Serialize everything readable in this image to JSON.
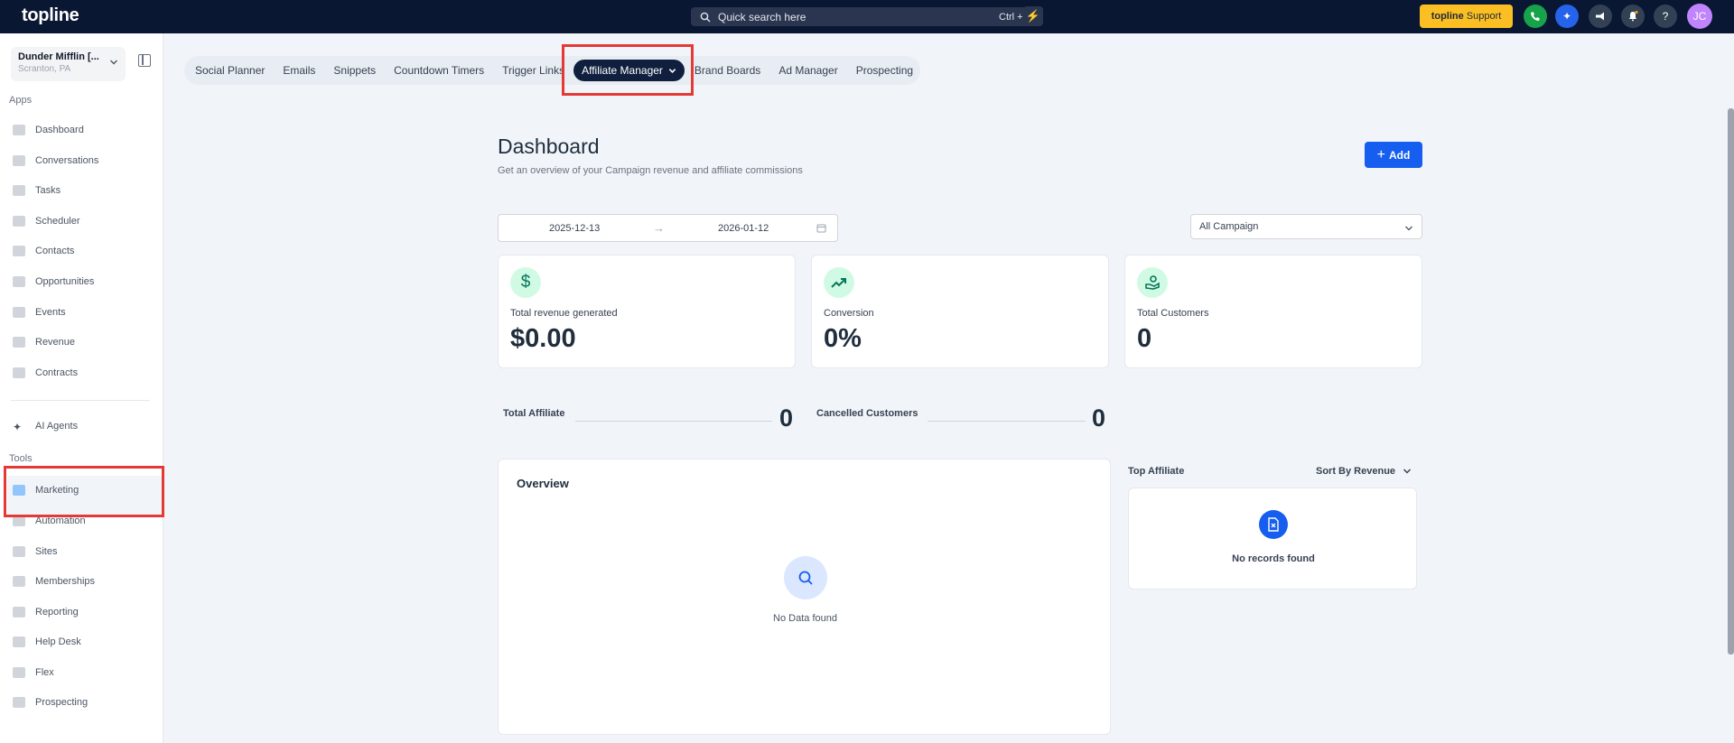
{
  "brand": {
    "logo": "topline"
  },
  "search": {
    "placeholder": "Quick search here",
    "shortcut": "Ctrl + K"
  },
  "header": {
    "support_brand": "topline",
    "support_label": "Support",
    "avatar_initials": "JC",
    "colors": {
      "support_bg": "#fbbf24",
      "phone": "#16a34a",
      "ai": "#2563eb",
      "avatar": "#c084fc"
    }
  },
  "account": {
    "name": "Dunder Mifflin [...",
    "location": "Scranton, PA"
  },
  "sidebar": {
    "apps_heading": "Apps",
    "apps": [
      {
        "label": "Dashboard",
        "icon": "dashboard-icon"
      },
      {
        "label": "Conversations",
        "icon": "chat-icon"
      },
      {
        "label": "Tasks",
        "icon": "tasks-icon"
      },
      {
        "label": "Scheduler",
        "icon": "calendar-icon"
      },
      {
        "label": "Contacts",
        "icon": "contact-icon"
      },
      {
        "label": "Opportunities",
        "icon": "opportunities-icon"
      },
      {
        "label": "Events",
        "icon": "events-icon"
      },
      {
        "label": "Revenue",
        "icon": "card-icon"
      },
      {
        "label": "Contracts",
        "icon": "contract-icon"
      }
    ],
    "ai_agents": "AI Agents",
    "tools_heading": "Tools",
    "tools": [
      {
        "label": "Marketing",
        "icon": "megaphone-icon",
        "active": true
      },
      {
        "label": "Automation",
        "icon": "automation-icon"
      },
      {
        "label": "Sites",
        "icon": "sites-icon"
      },
      {
        "label": "Memberships",
        "icon": "memberships-icon"
      },
      {
        "label": "Reporting",
        "icon": "reporting-icon"
      },
      {
        "label": "Help Desk",
        "icon": "help-icon"
      },
      {
        "label": "Flex",
        "icon": "flex-icon"
      },
      {
        "label": "Prospecting",
        "icon": "prospecting-icon"
      }
    ]
  },
  "tabs": [
    {
      "label": "Social Planner"
    },
    {
      "label": "Emails"
    },
    {
      "label": "Snippets"
    },
    {
      "label": "Countdown Timers"
    },
    {
      "label": "Trigger Links"
    },
    {
      "label": "Affiliate Manager",
      "active": true
    },
    {
      "label": "Brand Boards"
    },
    {
      "label": "Ad Manager"
    },
    {
      "label": "Prospecting"
    }
  ],
  "dashboard": {
    "title": "Dashboard",
    "subtitle": "Get an overview of your Campaign revenue and affiliate commissions",
    "add_label": "Add",
    "date_start": "2025-12-13",
    "date_end": "2026-01-12",
    "campaign_select": "All Campaign",
    "cards": [
      {
        "label": "Total revenue generated",
        "value": "$0.00",
        "icon": "dollar-icon"
      },
      {
        "label": "Conversion",
        "value": "0%",
        "icon": "trend-up-icon"
      },
      {
        "label": "Total Customers",
        "value": "0",
        "icon": "customers-icon"
      }
    ],
    "total_affiliate_label": "Total Affiliate",
    "total_affiliate_value": "0",
    "cancelled_label": "Cancelled Customers",
    "cancelled_value": "0",
    "overview_title": "Overview",
    "no_data": "No Data found",
    "top_affiliate_label": "Top Affiliate",
    "sort_label": "Sort By Revenue",
    "no_records": "No records found"
  }
}
